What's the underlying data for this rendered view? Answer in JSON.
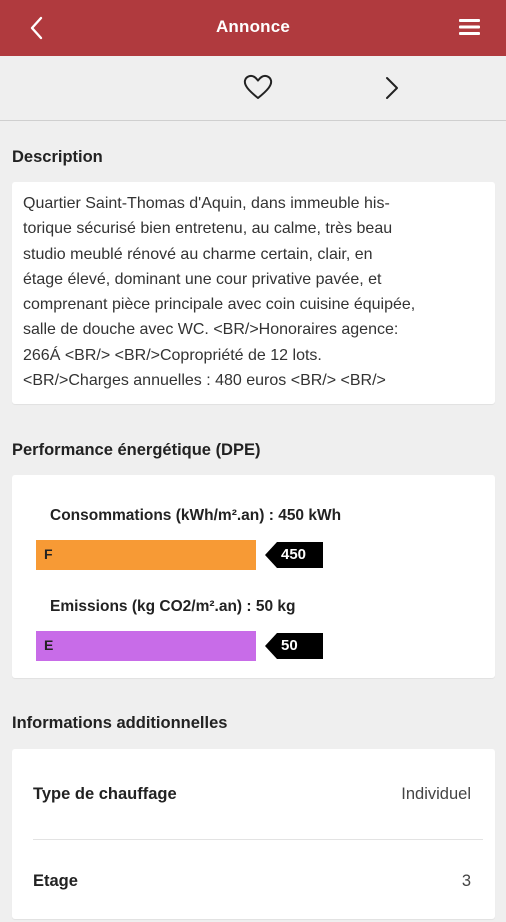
{
  "appbar": {
    "title": "Annonce"
  },
  "description": {
    "heading": "Description",
    "text": "Quartier Saint-Thomas d'Aquin, dans immeuble his-\ntorique sécurisé bien entretenu, au calme, très beau\nstudio meublé rénové au charme certain, clair, en\nétage élevé, dominant une cour privative pavée, et\ncomprenant pièce principale avec coin cuisine équipée,\nsalle de douche avec WC. <BR/>Honoraires agence:\n266Á <BR/> <BR/>Copropriété de 12 lots.\n<BR/>Charges annuelles : 480 euros <BR/> <BR/>"
  },
  "dpe": {
    "heading": "Performance énergétique (DPE)",
    "consumption": {
      "label": "Consommations (kWh/m².an) : 450 kWh",
      "letter": "F",
      "value": "450",
      "color": "#f79a35"
    },
    "emissions": {
      "label": "Emissions (kg CO2/m².an) : 50 kg",
      "letter": "E",
      "value": "50",
      "color": "#c86ce8"
    }
  },
  "info": {
    "heading": "Informations additionnelles",
    "rows": [
      {
        "key": "Type de chauffage",
        "value": "Individuel"
      },
      {
        "key": "Etage",
        "value": "3"
      }
    ]
  },
  "colors": {
    "appbar": "#b03a3e",
    "marker": "#000000"
  },
  "icons": {
    "back": "chevron-left-icon",
    "menu": "hamburger-menu-icon",
    "favorite": "heart-outline-icon",
    "next": "chevron-right-icon"
  }
}
